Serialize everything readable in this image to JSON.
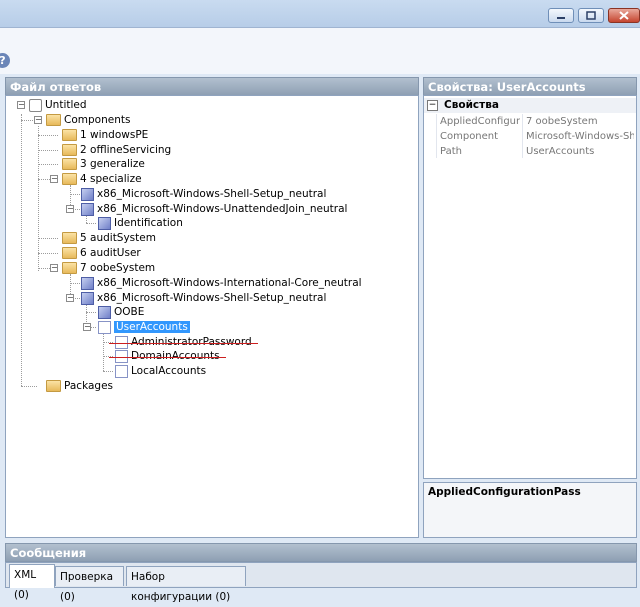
{
  "window": {
    "minimize": "minimize",
    "maximize": "maximize",
    "close": "close"
  },
  "left_pane": {
    "title": "Файл ответов"
  },
  "right_pane": {
    "title": "Свойства: UserAccounts",
    "section": "Свойства",
    "rows": [
      {
        "name": "AppliedConfiguratic",
        "value": "7 oobeSystem"
      },
      {
        "name": "Component",
        "value": "Microsoft-Windows-Shell-"
      },
      {
        "name": "Path",
        "value": "UserAccounts"
      }
    ],
    "description": "AppliedConfigurationPass"
  },
  "tree": {
    "root": "Untitled",
    "components": "Components",
    "windowsPE": "1 windowsPE",
    "offlineServicing": "2 offlineServicing",
    "generalize": "3 generalize",
    "specialize": "4 specialize",
    "shellSetup": "x86_Microsoft-Windows-Shell-Setup_neutral",
    "unattendedJoin": "x86_Microsoft-Windows-UnattendedJoin_neutral",
    "identification": "Identification",
    "auditSystem": "5 auditSystem",
    "auditUser": "6 auditUser",
    "oobeSystem": "7 oobeSystem",
    "intlCore": "x86_Microsoft-Windows-International-Core_neutral",
    "shellSetup2": "x86_Microsoft-Windows-Shell-Setup_neutral",
    "oobe": "OOBE",
    "userAccounts": "UserAccounts",
    "adminPassword": "AdministratorPassword",
    "domainAccounts": "DomainAccounts",
    "localAccounts": "LocalAccounts",
    "packages": "Packages"
  },
  "messages": {
    "title": "Сообщения",
    "tabs": [
      "XML (0)",
      "Проверка (0)",
      "Набор конфигурации (0)"
    ]
  }
}
